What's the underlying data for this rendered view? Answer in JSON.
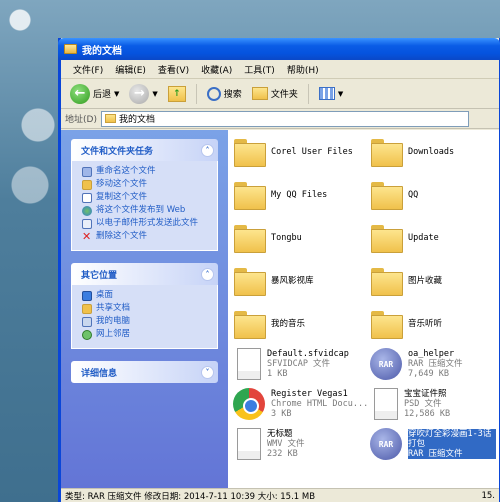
{
  "window": {
    "title": "我的文档"
  },
  "menu": [
    "文件(F)",
    "编辑(E)",
    "查看(V)",
    "收藏(A)",
    "工具(T)",
    "帮助(H)"
  ],
  "toolbar": {
    "back": "后退",
    "search": "搜索",
    "folders": "文件夹"
  },
  "address": {
    "label": "地址(D)",
    "value": "我的文档"
  },
  "sidebar": {
    "tasks": {
      "title": "文件和文件夹任务",
      "items": [
        "重命名这个文件",
        "移动这个文件",
        "复制这个文件",
        "将这个文件发布到 Web",
        "以电子邮件形式发送此文件",
        "删除这个文件"
      ]
    },
    "places": {
      "title": "其它位置",
      "items": [
        "桌面",
        "共享文档",
        "我的电脑",
        "网上邻居"
      ]
    },
    "details": {
      "title": "详细信息"
    }
  },
  "files": [
    {
      "name": "Corel User Files",
      "type": "folder"
    },
    {
      "name": "Downloads",
      "type": "folder"
    },
    {
      "name": "My QQ Files",
      "type": "folder"
    },
    {
      "name": "QQ",
      "type": "folder"
    },
    {
      "name": "Tongbu",
      "type": "folder"
    },
    {
      "name": "Update",
      "type": "folder"
    },
    {
      "name": "暴风影视库",
      "type": "folder"
    },
    {
      "name": "图片收藏",
      "type": "folder"
    },
    {
      "name": "我的音乐",
      "type": "folder"
    },
    {
      "name": "音乐听听",
      "type": "folder"
    },
    {
      "name": "Default.sfvidcap",
      "sub": "SFVIDCAP 文件",
      "size": "1 KB",
      "type": "doc"
    },
    {
      "name": "oa_helper",
      "sub": "RAR 压缩文件",
      "size": "7,649 KB",
      "type": "rar"
    },
    {
      "name": "Register Vegas1",
      "sub": "Chrome HTML Docu...",
      "size": "3 KB",
      "type": "chrome"
    },
    {
      "name": "宝宝证件照",
      "sub": "PSD 文件",
      "size": "12,586 KB",
      "type": "doc"
    },
    {
      "name": "无标题",
      "sub": "WMV 文件",
      "size": "232 KB",
      "type": "doc"
    },
    {
      "name": "穿吹灯全彩漫画1-3话打包",
      "sub": "RAR 压缩文件",
      "size": "",
      "type": "rar"
    }
  ],
  "status": {
    "left": "类型: RAR 压缩文件 修改日期: 2014-7-11 10:39 大小: 15.1 MB",
    "right": "15."
  }
}
